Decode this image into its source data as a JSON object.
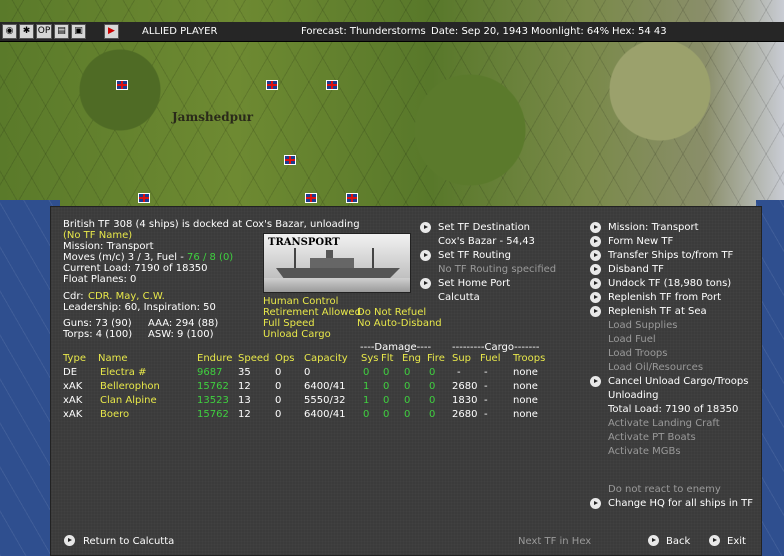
{
  "topbar": {
    "player": "ALLIED PLAYER",
    "forecast": "Forecast: Thunderstorms",
    "date": "Date: Sep 20, 1943",
    "moonlight": "Moonlight: 64%",
    "hex": "Hex: 54  43",
    "icons": [
      "globe-icon",
      "settings-icon",
      "op-icon",
      "log-icon",
      "screen-icon",
      "end-turn-icon"
    ],
    "op_label": "OP"
  },
  "map": {
    "city": "Jamshedpur"
  },
  "tf": {
    "header": "British TF 308 (4 ships) is docked at Cox's Bazar, unloading",
    "name": "(No TF Name)",
    "mission": "Mission: Transport",
    "moves_prefix": "Moves (m/c)  3 / 3, Fuel - ",
    "fuel": "76 / 8 (0)",
    "current_load": "Current Load: 7190 of 18350",
    "float_planes": "Float Planes: 0",
    "cdr_label": "Cdr:",
    "cdr_name": "CDR. May, C.W.",
    "leadership": "Leadership: 60, Inspiration: 50",
    "guns": "Guns: 73 (90)",
    "aaa": "AAA: 294 (88)",
    "torps": "Torps: 4 (100)",
    "asw": "ASW: 9 (100)",
    "picture_label": "TRANSPORT"
  },
  "orders": {
    "human_control": "Human Control",
    "retirement": "Retirement Allowed",
    "full_speed": "Full Speed",
    "unload_cargo": "Unload Cargo",
    "do_not_refuel": "Do Not Refuel",
    "no_auto_disband": "No Auto-Disband"
  },
  "destination": {
    "set_destination": "Set TF Destination",
    "destination_value": "Cox's Bazar - 54,43",
    "set_routing": "Set TF Routing",
    "routing_value": "No TF Routing specified",
    "set_home_port": "Set Home Port",
    "home_port_value": "Calcutta"
  },
  "table": {
    "group_damage": "----Damage----",
    "group_cargo": "---------Cargo-------",
    "headers": [
      "Type",
      "Name",
      "Endure",
      "Speed",
      "Ops",
      "Capacity",
      "Sys",
      "Flt",
      "Eng",
      "Fire",
      "Sup",
      "Fuel",
      "Troops"
    ],
    "rows": [
      [
        "DE",
        "Electra #",
        "9687",
        "35",
        "0",
        "0",
        "0",
        "0",
        "0",
        "0",
        "-",
        "-",
        "none"
      ],
      [
        "xAK",
        "Bellerophon",
        "15762",
        "12",
        "0",
        "6400/41",
        "1",
        "0",
        "0",
        "0",
        "2680",
        "-",
        "none"
      ],
      [
        "xAK",
        "Clan Alpine",
        "13523",
        "13",
        "0",
        "5550/32",
        "1",
        "0",
        "0",
        "0",
        "1830",
        "-",
        "none"
      ],
      [
        "xAK",
        "Boero",
        "15762",
        "12",
        "0",
        "6400/41",
        "0",
        "0",
        "0",
        "0",
        "2680",
        "-",
        "none"
      ]
    ]
  },
  "menu": {
    "active": [
      "Mission: Transport",
      "Form New TF",
      "Transfer Ships to/from TF",
      "Disband TF",
      "Undock TF (18,980 tons)",
      "Replenish TF from Port",
      "Replenish TF at Sea"
    ],
    "disabled_loads": [
      "Load Supplies",
      "Load Fuel",
      "Load Troops",
      "Load Oil/Resources"
    ],
    "cancel_unload": "Cancel Unload Cargo/Troops",
    "unloading": "Unloading",
    "total_load": "Total Load: 7190 of 18350",
    "disabled_more": [
      "Activate Landing Craft",
      "Activate PT Boats",
      "Activate MGBs"
    ],
    "no_react": "Do not react to enemy",
    "change_hq": "Change HQ for all ships in TF"
  },
  "footer": {
    "return": "Return to Calcutta",
    "next_tf": "Next TF in Hex",
    "back": "Back",
    "exit": "Exit"
  },
  "colors": {
    "highlight": "#e8e84a",
    "good": "#3fd03f",
    "disabled": "#9a9a9a",
    "panel": "#3b3b3b"
  }
}
